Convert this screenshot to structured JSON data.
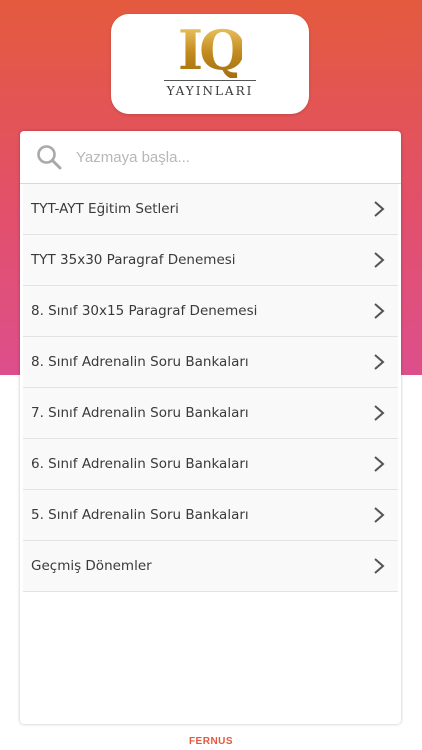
{
  "logo": {
    "mark": "IQ",
    "subtitle": "YAYINLARI"
  },
  "search": {
    "placeholder": "Yazmaya başla...",
    "value": "",
    "icon": "search-icon"
  },
  "items": [
    {
      "label": "TYT-AYT Eğitim Setleri"
    },
    {
      "label": "TYT 35x30 Paragraf Denemesi"
    },
    {
      "label": "8. Sınıf 30x15 Paragraf Denemesi"
    },
    {
      "label": "8. Sınıf Adrenalin Soru Bankaları"
    },
    {
      "label": "7. Sınıf Adrenalin Soru Bankaları"
    },
    {
      "label": "6. Sınıf Adrenalin Soru Bankaları"
    },
    {
      "label": "5. Sınıf Adrenalin Soru Bankaları"
    },
    {
      "label": "Geçmiş Dönemler"
    }
  ],
  "footer": {
    "brand": "FERNUS"
  },
  "colors": {
    "gradient_top": "#e45a3e",
    "gradient_bottom": "#dd4f8c",
    "gold": "#c89a2c",
    "footer_brand": "#e4583c"
  }
}
